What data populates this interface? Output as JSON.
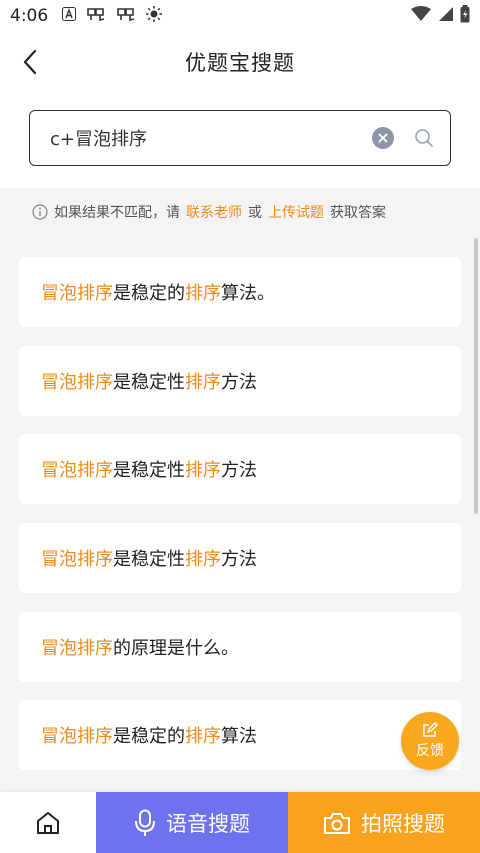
{
  "status_bar": {
    "time": "4:06"
  },
  "header": {
    "title": "优题宝搜题"
  },
  "search": {
    "query": "c+冒泡排序"
  },
  "notice": {
    "prefix": "如果结果不匹配，请",
    "link_contact": "联系老师",
    "or": "或",
    "link_upload": "上传试题",
    "suffix": "获取答案"
  },
  "results": [
    {
      "hl1": "冒泡排序",
      "mid": "是稳定的",
      "hl2": "排序",
      "tail": "算法。"
    },
    {
      "hl1": "冒泡排序",
      "mid": "是稳定性",
      "hl2": "排序",
      "tail": "方法"
    },
    {
      "hl1": "冒泡排序",
      "mid": "是稳定性",
      "hl2": "排序",
      "tail": "方法"
    },
    {
      "hl1": "冒泡排序",
      "mid": "是稳定性",
      "hl2": "排序",
      "tail": "方法"
    },
    {
      "hl1": "冒泡排序",
      "mid": "的原理是什么。",
      "hl2": "",
      "tail": ""
    },
    {
      "hl1": "冒泡排序",
      "mid": "是稳定的",
      "hl2": "排序",
      "tail": "算法"
    }
  ],
  "feedback": {
    "label": "反馈"
  },
  "bottom_bar": {
    "voice_label": "语音搜题",
    "photo_label": "拍照搜题"
  },
  "colors": {
    "accent": "#f08a17",
    "voice": "#6f72ee",
    "photo": "#f8a21d"
  },
  "icons": {
    "back": "chevron-left-icon",
    "clear": "clear-icon",
    "search": "search-icon",
    "info": "info-icon",
    "feedback": "edit-icon",
    "home": "home-icon",
    "mic": "mic-icon",
    "camera": "camera-icon"
  }
}
